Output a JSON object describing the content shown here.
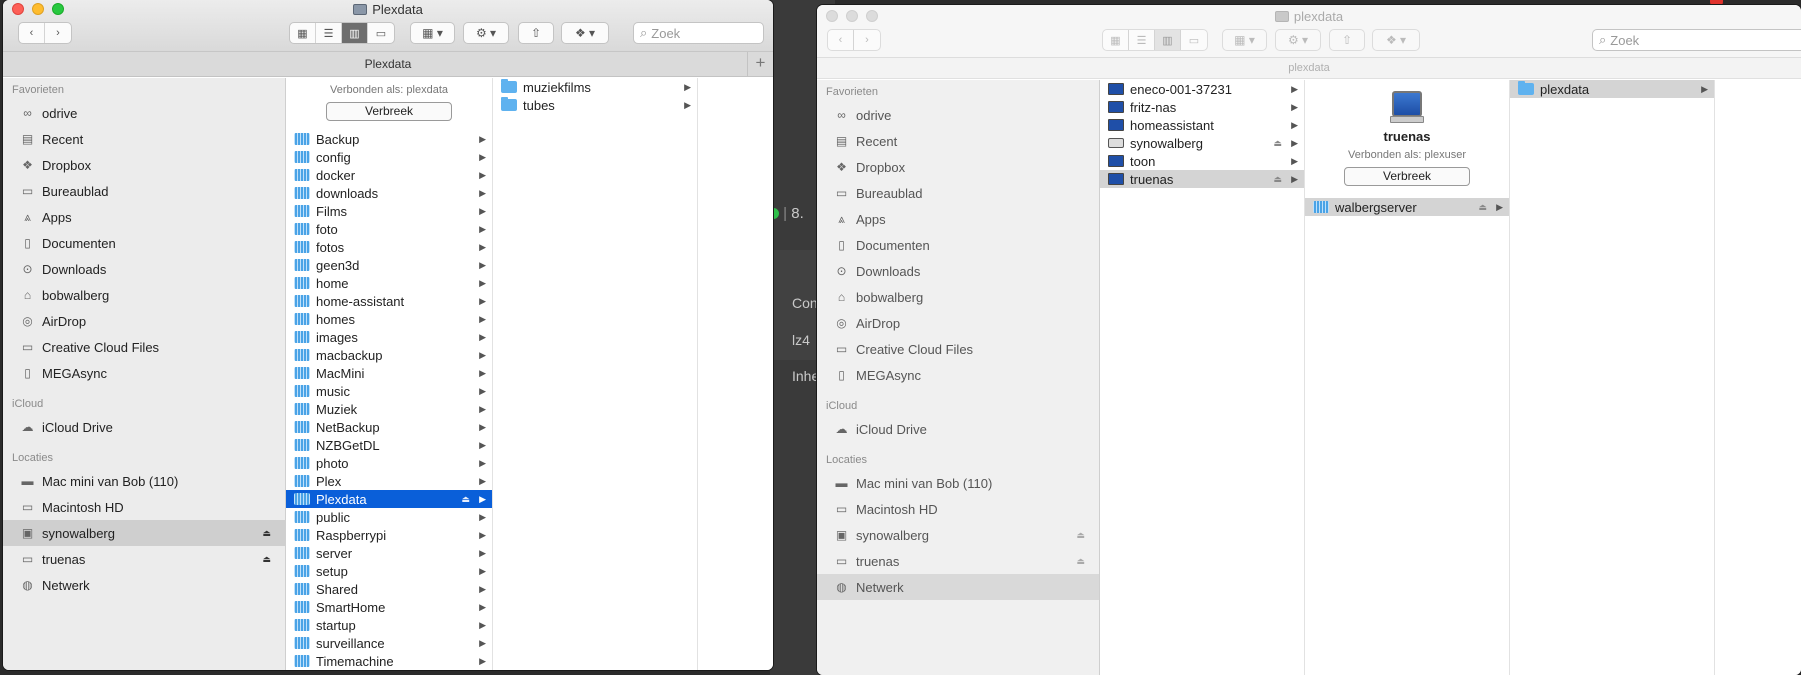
{
  "background": {
    "labels": [
      "8.",
      "Con",
      "lz4",
      "Inhe"
    ]
  },
  "window_left": {
    "title": "Plexdata",
    "tab_label": "Plexdata",
    "search_placeholder": "Zoek",
    "sidebar": {
      "sections": [
        {
          "title": "Favorieten",
          "items": [
            {
              "label": "odrive",
              "icon": "infinity-icon"
            },
            {
              "label": "Recent",
              "icon": "recent-icon"
            },
            {
              "label": "Dropbox",
              "icon": "dropbox-icon"
            },
            {
              "label": "Bureaublad",
              "icon": "desktop-icon"
            },
            {
              "label": "Apps",
              "icon": "apps-icon"
            },
            {
              "label": "Documenten",
              "icon": "document-icon"
            },
            {
              "label": "Downloads",
              "icon": "downloads-icon"
            },
            {
              "label": "bobwalberg",
              "icon": "home-icon"
            },
            {
              "label": "AirDrop",
              "icon": "airdrop-icon"
            },
            {
              "label": "Creative Cloud Files",
              "icon": "folder-icon"
            },
            {
              "label": "MEGAsync",
              "icon": "file-icon"
            }
          ]
        },
        {
          "title": "iCloud",
          "items": [
            {
              "label": "iCloud Drive",
              "icon": "cloud-icon"
            }
          ]
        },
        {
          "title": "Locaties",
          "items": [
            {
              "label": "Mac mini van Bob (110)",
              "icon": "mac-mini-icon"
            },
            {
              "label": "Macintosh HD",
              "icon": "hard-drive-icon"
            },
            {
              "label": "synowalberg",
              "icon": "nas-icon",
              "selected": true,
              "eject": true
            },
            {
              "label": "truenas",
              "icon": "monitor-icon",
              "eject": true
            },
            {
              "label": "Netwerk",
              "icon": "network-icon"
            }
          ]
        }
      ]
    },
    "column1": {
      "connected_as": "Verbonden als: plexdata",
      "disconnect_label": "Verbreek",
      "items": [
        "Backup",
        "config",
        "docker",
        "downloads",
        "Films",
        "foto",
        "fotos",
        "geen3d",
        "home",
        "home-assistant",
        "homes",
        "images",
        "macbackup",
        "MacMini",
        "music",
        "Muziek",
        "NetBackup",
        "NZBGetDL",
        "photo",
        "Plex",
        "Plexdata",
        "public",
        "Raspberrypi",
        "server",
        "setup",
        "Shared",
        "SmartHome",
        "startup",
        "surveillance",
        "Timemachine"
      ],
      "selected": "Plexdata"
    },
    "column2": {
      "items": [
        "muziekfilms",
        "tubes"
      ]
    }
  },
  "window_right": {
    "title": "plexdata",
    "tab_label": "plexdata",
    "search_placeholder": "Zoek",
    "sidebar": {
      "sections": [
        {
          "title": "Favorieten",
          "items": [
            {
              "label": "odrive",
              "icon": "infinity-icon"
            },
            {
              "label": "Recent",
              "icon": "recent-icon"
            },
            {
              "label": "Dropbox",
              "icon": "dropbox-icon"
            },
            {
              "label": "Bureaublad",
              "icon": "desktop-icon"
            },
            {
              "label": "Apps",
              "icon": "apps-icon"
            },
            {
              "label": "Documenten",
              "icon": "document-icon"
            },
            {
              "label": "Downloads",
              "icon": "downloads-icon"
            },
            {
              "label": "bobwalberg",
              "icon": "home-icon"
            },
            {
              "label": "AirDrop",
              "icon": "airdrop-icon"
            },
            {
              "label": "Creative Cloud Files",
              "icon": "folder-icon"
            },
            {
              "label": "MEGAsync",
              "icon": "file-icon"
            }
          ]
        },
        {
          "title": "iCloud",
          "items": [
            {
              "label": "iCloud Drive",
              "icon": "cloud-icon"
            }
          ]
        },
        {
          "title": "Locaties",
          "items": [
            {
              "label": "Mac mini van Bob (110)",
              "icon": "mac-mini-icon"
            },
            {
              "label": "Macintosh HD",
              "icon": "hard-drive-icon"
            },
            {
              "label": "synowalberg",
              "icon": "nas-icon",
              "eject": true
            },
            {
              "label": "truenas",
              "icon": "monitor-icon",
              "eject": true
            },
            {
              "label": "Netwerk",
              "icon": "network-icon",
              "selected": true
            }
          ]
        }
      ]
    },
    "column1": {
      "items": [
        {
          "label": "eneco-001-37231",
          "icon": "monitor"
        },
        {
          "label": "fritz-nas",
          "icon": "monitor"
        },
        {
          "label": "homeassistant",
          "icon": "monitor"
        },
        {
          "label": "synowalberg",
          "icon": "nas",
          "eject": true
        },
        {
          "label": "toon",
          "icon": "monitor"
        },
        {
          "label": "truenas",
          "icon": "monitor",
          "eject": true,
          "selected": true
        }
      ]
    },
    "column2": {
      "host_name": "truenas",
      "connected_as": "Verbonden als: plexuser",
      "disconnect_label": "Verbreek",
      "items": [
        {
          "label": "walbergserver",
          "eject": true,
          "selected": true
        }
      ]
    },
    "column3": {
      "items": [
        {
          "label": "plexdata",
          "selected": true
        }
      ]
    }
  }
}
